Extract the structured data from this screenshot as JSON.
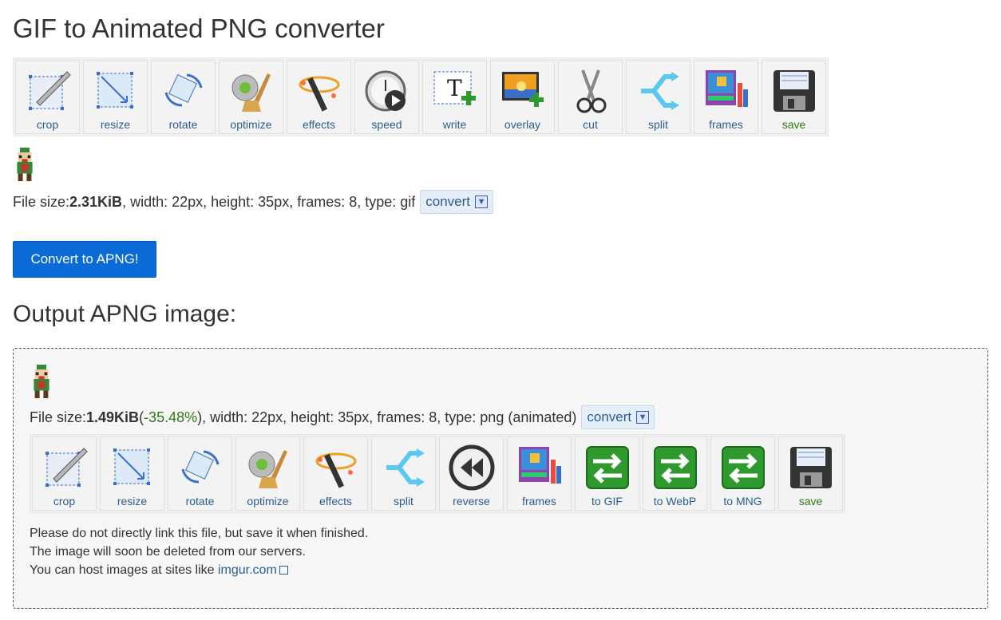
{
  "title": "GIF to Animated PNG converter",
  "input": {
    "tools": [
      {
        "label": "crop",
        "icon": "crop-icon"
      },
      {
        "label": "resize",
        "icon": "resize-icon"
      },
      {
        "label": "rotate",
        "icon": "rotate-icon"
      },
      {
        "label": "optimize",
        "icon": "optimize-icon"
      },
      {
        "label": "effects",
        "icon": "effects-icon"
      },
      {
        "label": "speed",
        "icon": "speed-icon"
      },
      {
        "label": "write",
        "icon": "write-icon"
      },
      {
        "label": "overlay",
        "icon": "overlay-icon"
      },
      {
        "label": "cut",
        "icon": "cut-icon"
      },
      {
        "label": "split",
        "icon": "split-icon"
      },
      {
        "label": "frames",
        "icon": "frames-icon"
      },
      {
        "label": "save",
        "icon": "save-icon"
      }
    ],
    "info": {
      "prefix": "File size: ",
      "size": "2.31KiB",
      "rest": ", width: 22px, height: 35px, frames: 8, type: gif",
      "convert_label": "convert"
    }
  },
  "convert_button": "Convert to APNG!",
  "output": {
    "heading": "Output APNG image:",
    "info": {
      "prefix": "File size: ",
      "size": "1.49KiB",
      "pct_open": " (",
      "pct": "-35.48%",
      "rest": "), width: 22px, height: 35px, frames: 8, type: png (animated)",
      "convert_label": "convert"
    },
    "tools": [
      {
        "label": "crop",
        "icon": "crop-icon"
      },
      {
        "label": "resize",
        "icon": "resize-icon"
      },
      {
        "label": "rotate",
        "icon": "rotate-icon"
      },
      {
        "label": "optimize",
        "icon": "optimize-icon"
      },
      {
        "label": "effects",
        "icon": "effects-icon"
      },
      {
        "label": "split",
        "icon": "split-icon"
      },
      {
        "label": "reverse",
        "icon": "reverse-icon"
      },
      {
        "label": "frames",
        "icon": "frames-icon"
      },
      {
        "label": "to GIF",
        "icon": "to-gif-icon"
      },
      {
        "label": "to WebP",
        "icon": "to-webp-icon"
      },
      {
        "label": "to MNG",
        "icon": "to-mng-icon"
      },
      {
        "label": "save",
        "icon": "save-icon"
      }
    ],
    "note_line1": "Please do not directly link this file, but save it when finished.",
    "note_line2": "The image will soon be deleted from our servers.",
    "note_line3_prefix": "You can host images at sites like ",
    "note_link": "imgur.com"
  },
  "colors": {
    "link": "#2a5d8f",
    "save": "#2c7a16",
    "button": "#0a6ad6",
    "positive": "#2c7a16"
  }
}
